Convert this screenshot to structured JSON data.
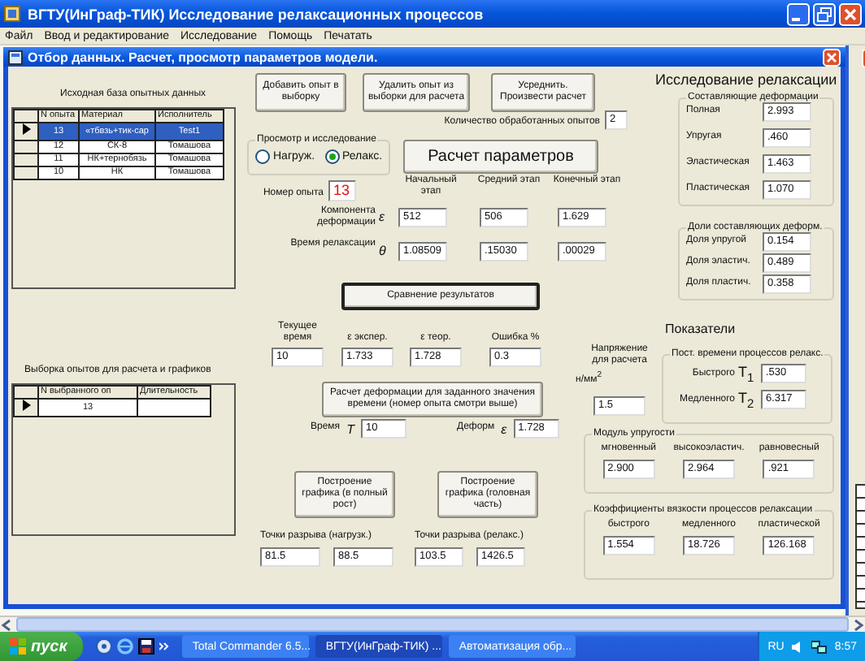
{
  "window": {
    "title": "ВГТУ(ИнГраф-ТИК)  Исследование релаксационных процессов"
  },
  "menu": [
    "Файл",
    "Ввод и редактирование",
    "Исследование",
    "Помощь",
    "Печатать"
  ],
  "dialog": {
    "title": "Отбор данных.   Расчет, просмотр параметров модели."
  },
  "source_table": {
    "caption": "Исходная база опытных данных",
    "columns": [
      "N опыта",
      "Материал",
      "Исполнитель"
    ],
    "rows": [
      {
        "cells": [
          "13",
          "«тбвзь+тик-сар",
          "Test1"
        ],
        "selected": true,
        "current": true
      },
      {
        "cells": [
          "12",
          "СК-8",
          "Томашова"
        ],
        "selected": false,
        "current": false
      },
      {
        "cells": [
          "11",
          "НК+тернобязь",
          "Томашова"
        ],
        "selected": false,
        "current": false
      },
      {
        "cells": [
          "10",
          "НК",
          "Томашова"
        ],
        "selected": false,
        "current": false
      }
    ]
  },
  "selection_table": {
    "caption": "Выборка опытов для  расчета и графиков",
    "columns": [
      "N выбранного  оп",
      "Длительность"
    ],
    "rows": [
      {
        "cells": [
          "13"
        ],
        "selected": false,
        "current": true
      }
    ]
  },
  "add_button": "Добавить опыт в выборку",
  "remove_button": "Удалить опыт из выборки для расчета",
  "average_button": "Усреднить. Произвести расчет",
  "processed_count": {
    "label": "Количество обработанных опытов",
    "value": "2"
  },
  "view_mode": {
    "title": "Просмотр и исследование",
    "options": [
      {
        "label": "Нагруж.",
        "selected": false
      },
      {
        "label": "Релакс.",
        "selected": true
      }
    ]
  },
  "calculate_button": "Расчет параметров",
  "experiment_number": {
    "label": "Номер опыта",
    "value": "13"
  },
  "stages": [
    "Начальный этап",
    "Средний этап",
    "Конечный этап"
  ],
  "parameter_rows": [
    {
      "label": "Компонента деформации",
      "symbol": "ε",
      "values": [
        "512",
        "506",
        "1.629"
      ]
    },
    {
      "label": "Время релаксации",
      "symbol": "θ",
      "values": [
        "1.08509",
        ".15030",
        ".00029"
      ]
    }
  ],
  "compare_button": "Сравнение результатов",
  "comparison": [
    {
      "label": "Текущее время",
      "value": "10"
    },
    {
      "label": "ε  экспер.",
      "value": "1.733"
    },
    {
      "label": "ε  теор.",
      "value": "1.728"
    },
    {
      "label": "Ошибка %",
      "value": "0.3"
    }
  ],
  "deformation_button": "Расчет деформации для заданного значения времени  (номер опыта смотри выше)",
  "time_input": {
    "label": "Время",
    "symbol": "T",
    "value": "10"
  },
  "deformation_output": {
    "label": "Деформ",
    "symbol": "ε",
    "value": "1.728"
  },
  "plot_buttons": [
    "Построение графика (в полный рост)",
    "Построение графика (головная часть)"
  ],
  "break_points": [
    {
      "label": "Точки  разрыва (нагрузк.)",
      "values": [
        "81.5",
        "88.5"
      ]
    },
    {
      "label": "Точки разрыва (релакс.)",
      "values": [
        "103.5",
        "1426.5"
      ]
    }
  ],
  "research_title": "Исследование релаксации",
  "deformation_components": {
    "title": "Составляющие деформации",
    "items": [
      {
        "label": "Полная",
        "value": "2.993"
      },
      {
        "label": "Упругая",
        "value": ".460"
      },
      {
        "label": "Эластическая",
        "value": "1.463"
      },
      {
        "label": "Пластическая",
        "value": "1.070"
      }
    ]
  },
  "deformation_shares": {
    "title": "Доли составляющих деформ.",
    "items": [
      {
        "label": "Доля упругой",
        "value": "0.154"
      },
      {
        "label": "Доля эластич.",
        "value": "0.489"
      },
      {
        "label": "Доля пластич.",
        "value": "0.358"
      }
    ]
  },
  "indicators_title": "Показатели",
  "stress": {
    "label": "Напряжение для расчета",
    "unit": "н/мм$^{2}$",
    "value": "1.5"
  },
  "time_constants": {
    "title": "Пост. времени процессов релакс.",
    "items": [
      {
        "label": "Быстрого",
        "symbol": "T$_{1}$",
        "value": ".530"
      },
      {
        "label": "Медленного",
        "symbol": "T$_{2}$",
        "value": "6.317"
      }
    ]
  },
  "elastic_modulus": {
    "title": "Модуль упругости",
    "items": [
      {
        "label": "мгновенный",
        "value": "2.900"
      },
      {
        "label": "высокоэластич.",
        "value": "2.964"
      },
      {
        "label": "равновесный",
        "value": ".921"
      }
    ]
  },
  "viscosity": {
    "title": "Коэффициенты вязкости процессов релаксации",
    "items": [
      {
        "label": "быстрого",
        "value": "1.554"
      },
      {
        "label": "медленного",
        "value": "18.726"
      },
      {
        "label": "пластической",
        "value": "126.168"
      }
    ]
  },
  "taskbar": {
    "start": "пуск",
    "tasks": [
      {
        "label": "Total Commander 6.5...",
        "selected": false
      },
      {
        "label": "ВГТУ(ИнГраф-ТИК) ...",
        "selected": true
      },
      {
        "label": "Автоматизация обр...",
        "selected": false
      }
    ],
    "language": "RU",
    "clock": "8:57"
  }
}
